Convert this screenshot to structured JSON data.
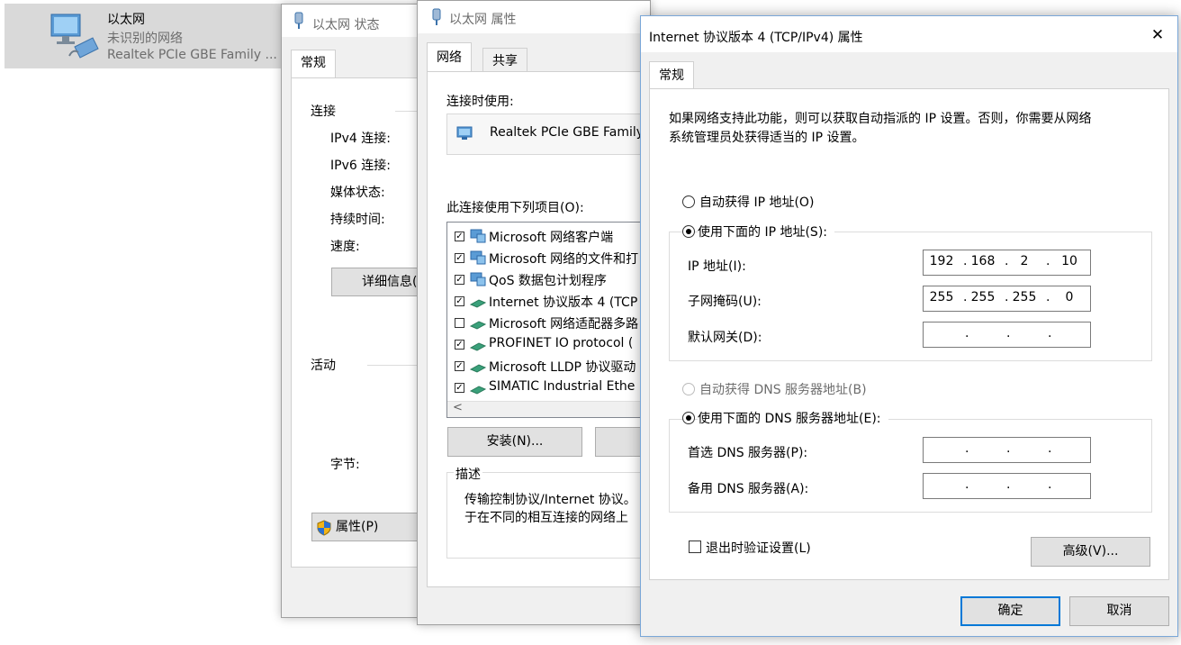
{
  "adapter": {
    "name": "以太网",
    "status": "未识别的网络",
    "device": "Realtek PCIe GBE Family ..."
  },
  "status_window": {
    "title": "以太网 状态",
    "tab": "常规",
    "connection_section": "连接",
    "rows": [
      "IPv4 连接:",
      "IPv6 连接:",
      "媒体状态:",
      "持续时间:",
      "速度:"
    ],
    "details_button": "详细信息(",
    "activity_section": "活动",
    "bytes_label": "字节:",
    "properties_button": "属性(P)"
  },
  "props_window": {
    "title": "以太网 属性",
    "tabs": [
      "网络",
      "共享"
    ],
    "connect_using_label": "连接时使用:",
    "adapter_name": "Realtek PCIe GBE Family",
    "items_label": "此连接使用下列项目(O):",
    "items": [
      {
        "label": "Microsoft 网络客户端",
        "checked": true
      },
      {
        "label": "Microsoft 网络的文件和打",
        "checked": true
      },
      {
        "label": "QoS 数据包计划程序",
        "checked": true
      },
      {
        "label": "Internet 协议版本 4 (TCP",
        "checked": true
      },
      {
        "label": "Microsoft 网络适配器多路",
        "checked": false
      },
      {
        "label": "PROFINET IO protocol (",
        "checked": true
      },
      {
        "label": "Microsoft LLDP 协议驱动",
        "checked": true
      },
      {
        "label": "SIMATIC Industrial Ethe",
        "checked": true
      }
    ],
    "scroll_left": "<",
    "install_button": "安装(N)...",
    "description_section": "描述",
    "description_line1": "传输控制协议/Internet 协议。",
    "description_line2": "于在不同的相互连接的网络上"
  },
  "ipv4_dialog": {
    "title": "Internet 协议版本 4 (TCP/IPv4) 属性",
    "close_glyph": "✕",
    "tab": "常规",
    "intro_line1": "如果网络支持此功能，则可以获取自动指派的 IP 设置。否则，你需要从网络",
    "intro_line2": "系统管理员处获得适当的 IP 设置。",
    "auto_ip": "自动获得 IP 地址(O)",
    "manual_ip": "使用下面的 IP 地址(S):",
    "ip_label": "IP 地址(I):",
    "ip_octets": [
      "192",
      "168",
      "2",
      "10"
    ],
    "subnet_label": "子网掩码(U):",
    "subnet_octets": [
      "255",
      "255",
      "255",
      "0"
    ],
    "gateway_label": "默认网关(D):",
    "auto_dns": "自动获得 DNS 服务器地址(B)",
    "manual_dns": "使用下面的 DNS 服务器地址(E):",
    "preferred_dns_label": "首选 DNS 服务器(P):",
    "alternate_dns_label": "备用 DNS 服务器(A):",
    "validate_label": "退出时验证设置(L)",
    "advanced_button": "高级(V)...",
    "ok_button": "确定",
    "cancel_button": "取消"
  },
  "colors": {
    "accent": "#0078d7",
    "window_bg": "#f0f0f0"
  }
}
